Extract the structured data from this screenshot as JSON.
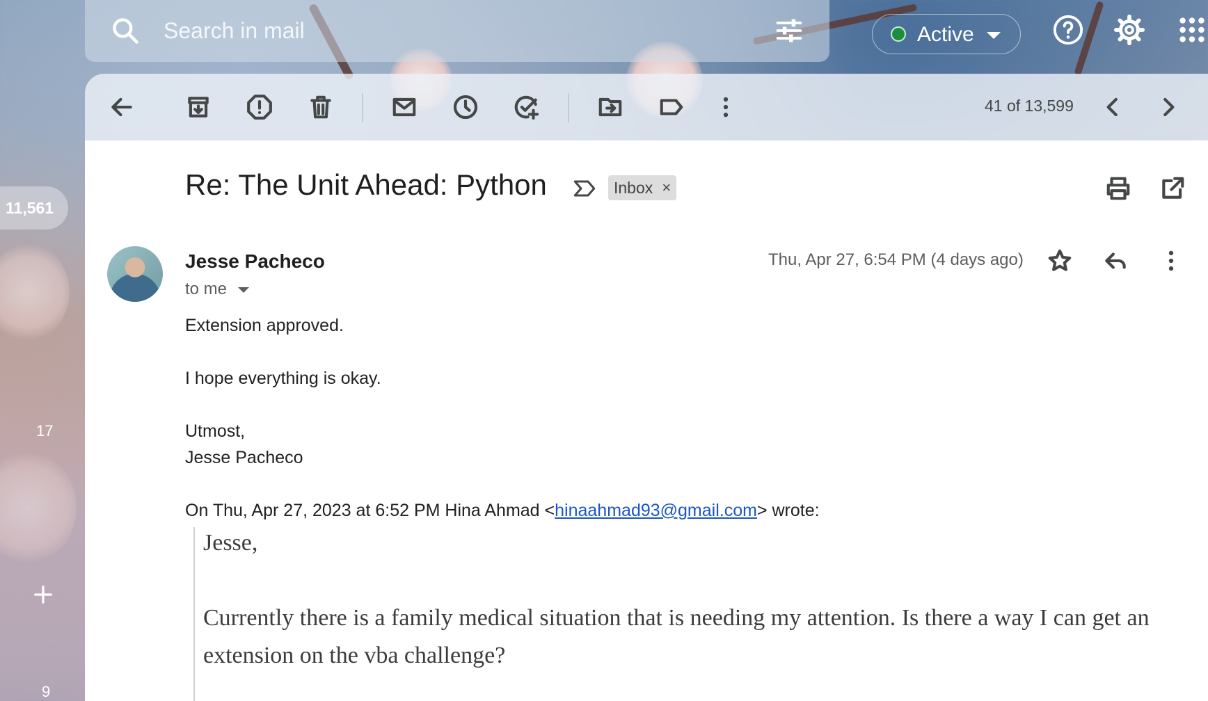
{
  "search": {
    "placeholder": "Search in mail",
    "icon": "search-icon",
    "filter_icon": "tune-icon"
  },
  "status": {
    "label": "Active",
    "color": "#1e8e3e"
  },
  "top_icons": [
    "help-icon",
    "settings-icon",
    "apps-icon"
  ],
  "left_rail": {
    "inbox_count": "11,561",
    "chat_count": "17",
    "meet_count": "9"
  },
  "toolbar": {
    "icons": [
      "back-icon",
      "archive-icon",
      "report-spam-icon",
      "delete-icon",
      "mark-unread-icon",
      "snooze-icon",
      "add-task-icon",
      "move-to-icon",
      "label-icon",
      "more-icon"
    ],
    "pager": "41 of 13,599"
  },
  "email": {
    "subject": "Re: The Unit Ahead: Python",
    "chip": "Inbox",
    "chip_close": "×",
    "sender": "Jesse Pacheco",
    "recipient": "to me",
    "date": "Thu, Apr 27, 6:54 PM (4 days ago)",
    "body": [
      "Extension approved.",
      "I hope everything is okay.",
      "Utmost,",
      "Jesse Pacheco"
    ],
    "quote_intro_prefix": "On Thu, Apr 27, 2023 at 6:52 PM Hina Ahmad <",
    "quote_email": "hinaahmad93@gmail.com",
    "quote_intro_suffix": "> wrote:",
    "quote": [
      "Jesse,",
      "Currently there is a family medical situation that is needing my attention. Is there a way I can get an extension on the vba challenge?"
    ]
  }
}
